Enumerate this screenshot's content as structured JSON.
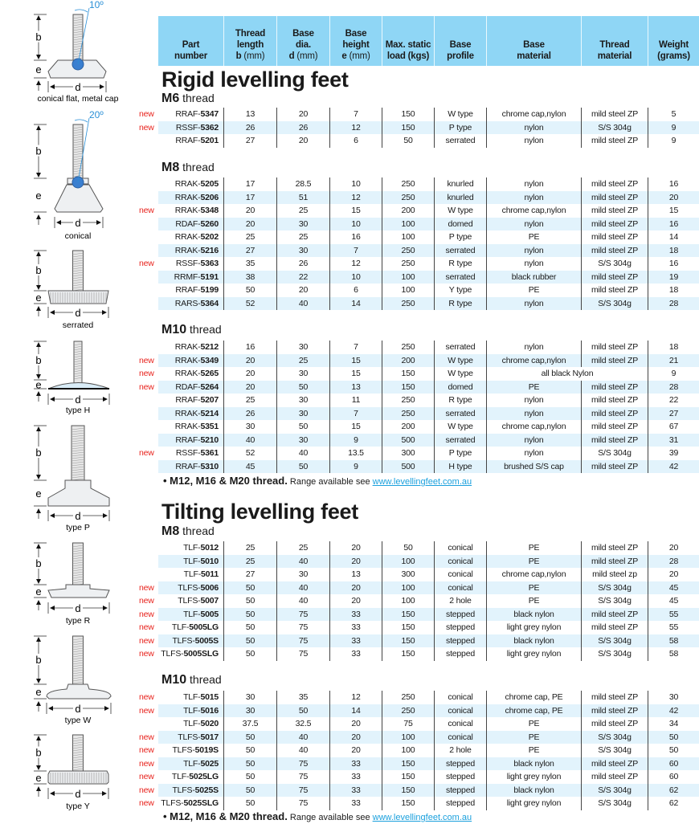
{
  "labels": {
    "new": "new"
  },
  "header": {
    "columns": [
      {
        "lines": [
          "Part",
          "number"
        ],
        "unit": ""
      },
      {
        "lines": [
          "Thread",
          "length",
          "b"
        ],
        "unit": " (mm)"
      },
      {
        "lines": [
          "Base",
          "dia.",
          "d"
        ],
        "unit": " (mm)"
      },
      {
        "lines": [
          "Base",
          "height",
          "e"
        ],
        "unit": " (mm)"
      },
      {
        "lines": [
          "Max. static",
          "load (kgs)"
        ],
        "unit": ""
      },
      {
        "lines": [
          "Base",
          "profile"
        ],
        "unit": ""
      },
      {
        "lines": [
          "Base",
          "material"
        ],
        "unit": ""
      },
      {
        "lines": [
          "Thread",
          "material"
        ],
        "unit": ""
      },
      {
        "lines": [
          "Weight",
          "(grams)"
        ],
        "unit": ""
      }
    ]
  },
  "sections": [
    {
      "title": "Rigid levelling feet",
      "groups": [
        {
          "thread_bold": "M6",
          "thread_label": " thread",
          "rows": [
            {
              "new": true,
              "part": "RRAF-5347",
              "b": "13",
              "d": "20",
              "e": "7",
              "load": "150",
              "profile": "W type",
              "material": "chrome cap,nylon",
              "thread_material": "mild steel ZP",
              "weight": "5"
            },
            {
              "new": true,
              "part": "RSSF-5362",
              "b": "26",
              "d": "26",
              "e": "12",
              "load": "150",
              "profile": "P type",
              "material": "nylon",
              "thread_material": "S/S 304g",
              "weight": "9"
            },
            {
              "new": false,
              "part": "RRAF-5201",
              "b": "27",
              "d": "20",
              "e": "6",
              "load": "50",
              "profile": "serrated",
              "material": "nylon",
              "thread_material": "mild steel ZP",
              "weight": "9"
            }
          ]
        },
        {
          "thread_bold": "M8",
          "thread_label": " thread",
          "rows": [
            {
              "new": false,
              "part": "RRAK-5205",
              "b": "17",
              "d": "28.5",
              "e": "10",
              "load": "250",
              "profile": "knurled",
              "material": "nylon",
              "thread_material": "mild steel ZP",
              "weight": "16"
            },
            {
              "new": false,
              "part": "RRAK-5206",
              "b": "17",
              "d": "51",
              "e": "12",
              "load": "250",
              "profile": "knurled",
              "material": "nylon",
              "thread_material": "mild steel ZP",
              "weight": "20"
            },
            {
              "new": true,
              "part": "RRAK-5348",
              "b": "20",
              "d": "25",
              "e": "15",
              "load": "200",
              "profile": "W type",
              "material": "chrome cap,nylon",
              "thread_material": "mild steel ZP",
              "weight": "15"
            },
            {
              "new": false,
              "part": "RDAF-5260",
              "b": "20",
              "d": "30",
              "e": "10",
              "load": "100",
              "profile": "domed",
              "material": "nylon",
              "thread_material": "mild steel ZP",
              "weight": "16"
            },
            {
              "new": false,
              "part": "RRAK-5202",
              "b": "25",
              "d": "25",
              "e": "16",
              "load": "100",
              "profile": "P type",
              "material": "PE",
              "thread_material": "mild steel ZP",
              "weight": "14"
            },
            {
              "new": false,
              "part": "RRAK-5216",
              "b": "27",
              "d": "30",
              "e": "7",
              "load": "250",
              "profile": "serrated",
              "material": "nylon",
              "thread_material": "mild steel ZP",
              "weight": "18"
            },
            {
              "new": true,
              "part": "RSSF-5363",
              "b": "35",
              "d": "26",
              "e": "12",
              "load": "250",
              "profile": "R type",
              "material": "nylon",
              "thread_material": "S/S 304g",
              "weight": "16"
            },
            {
              "new": false,
              "part": "RRMF-5191",
              "b": "38",
              "d": "22",
              "e": "10",
              "load": "100",
              "profile": "serrated",
              "material": "black rubber",
              "thread_material": "mild steel ZP",
              "weight": "19"
            },
            {
              "new": false,
              "part": "RRAF-5199",
              "b": "50",
              "d": "20",
              "e": "6",
              "load": "100",
              "profile": "Y type",
              "material": "PE",
              "thread_material": "mild steel ZP",
              "weight": "18"
            },
            {
              "new": false,
              "part": "RARS-5364",
              "b": "52",
              "d": "40",
              "e": "14",
              "load": "250",
              "profile": "R type",
              "material": "nylon",
              "thread_material": "S/S 304g",
              "weight": "28"
            }
          ]
        },
        {
          "thread_bold": "M10",
          "thread_label": " thread",
          "rows": [
            {
              "new": false,
              "part": "RRAK-5212",
              "b": "16",
              "d": "30",
              "e": "7",
              "load": "250",
              "profile": "serrated",
              "material": "nylon",
              "thread_material": "mild steel ZP",
              "weight": "18"
            },
            {
              "new": true,
              "part": "RRAK-5349",
              "b": "20",
              "d": "25",
              "e": "15",
              "load": "200",
              "profile": "W type",
              "material": "chrome cap,nylon",
              "thread_material": "mild steel ZP",
              "weight": "21"
            },
            {
              "new": true,
              "part": "RRAK-5265",
              "b": "20",
              "d": "30",
              "e": "15",
              "load": "150",
              "profile": "W type",
              "material": "all black Nylon",
              "thread_material": null,
              "weight": "9",
              "merged": true
            },
            {
              "new": true,
              "part": "RDAF-5264",
              "b": "20",
              "d": "50",
              "e": "13",
              "load": "150",
              "profile": "domed",
              "material": "PE",
              "thread_material": "mild steel ZP",
              "weight": "28"
            },
            {
              "new": false,
              "part": "RRAF-5207",
              "b": "25",
              "d": "30",
              "e": "11",
              "load": "250",
              "profile": "R type",
              "material": "nylon",
              "thread_material": "mild steel ZP",
              "weight": "22"
            },
            {
              "new": false,
              "part": "RRAK-5214",
              "b": "26",
              "d": "30",
              "e": "7",
              "load": "250",
              "profile": "serrated",
              "material": "nylon",
              "thread_material": "mild steel ZP",
              "weight": "27"
            },
            {
              "new": false,
              "part": "RRAK-5351",
              "b": "30",
              "d": "50",
              "e": "15",
              "load": "200",
              "profile": "W type",
              "material": "chrome cap,nylon",
              "thread_material": "mild steel ZP",
              "weight": "67"
            },
            {
              "new": false,
              "part": "RRAF-5210",
              "b": "40",
              "d": "30",
              "e": "9",
              "load": "500",
              "profile": "serrated",
              "material": "nylon",
              "thread_material": "mild steel ZP",
              "weight": "31"
            },
            {
              "new": true,
              "part": "RSSF-5361",
              "b": "52",
              "d": "40",
              "e": "13.5",
              "load": "300",
              "profile": "P type",
              "material": "nylon",
              "thread_material": "S/S 304g",
              "weight": "39"
            },
            {
              "new": false,
              "part": "RRAF-5310",
              "b": "45",
              "d": "50",
              "e": "9",
              "load": "500",
              "profile": "H type",
              "material": "brushed S/S cap",
              "thread_material": "mild steel ZP",
              "weight": "42"
            }
          ]
        }
      ],
      "footer": {
        "bullet": "•",
        "bold": "M12, M16 & M20 thread.",
        "text": " Range available see ",
        "link": "www.levellingfeet.com.au"
      }
    },
    {
      "title": "Tilting levelling feet",
      "groups": [
        {
          "thread_bold": "M8",
          "thread_label": " thread",
          "rows": [
            {
              "new": false,
              "part": "TLF-5012",
              "b": "25",
              "d": "25",
              "e": "20",
              "load": "50",
              "profile": "conical",
              "material": "PE",
              "thread_material": "mild steel ZP",
              "weight": "20"
            },
            {
              "new": false,
              "part": "TLF-5010",
              "b": "25",
              "d": "40",
              "e": "20",
              "load": "100",
              "profile": "conical",
              "material": "PE",
              "thread_material": "mild steel ZP",
              "weight": "28"
            },
            {
              "new": false,
              "part": "TLF-5011",
              "b": "27",
              "d": "30",
              "e": "13",
              "load": "300",
              "profile": "conical",
              "material": "chrome cap,nylon",
              "thread_material": "mild steel zp",
              "weight": "20"
            },
            {
              "new": true,
              "part": "TLFS-5006",
              "b": "50",
              "d": "40",
              "e": "20",
              "load": "100",
              "profile": "conical",
              "material": "PE",
              "thread_material": "S/S 304g",
              "weight": "45"
            },
            {
              "new": true,
              "part": "TLFS-5007",
              "b": "50",
              "d": "40",
              "e": "20",
              "load": "100",
              "profile": "2 hole",
              "material": "PE",
              "thread_material": "S/S 304g",
              "weight": "45"
            },
            {
              "new": true,
              "part": "TLF-5005",
              "b": "50",
              "d": "75",
              "e": "33",
              "load": "150",
              "profile": "stepped",
              "material": "black nylon",
              "thread_material": "mild steel ZP",
              "weight": "55"
            },
            {
              "new": true,
              "part": "TLF-5005LG",
              "b": "50",
              "d": "75",
              "e": "33",
              "load": "150",
              "profile": "stepped",
              "material": "light grey nylon",
              "thread_material": "mild steel ZP",
              "weight": "55"
            },
            {
              "new": true,
              "part": "TLFS-5005S",
              "b": "50",
              "d": "75",
              "e": "33",
              "load": "150",
              "profile": "stepped",
              "material": "black nylon",
              "thread_material": "S/S 304g",
              "weight": "58"
            },
            {
              "new": true,
              "part": "TLFS-5005SLG",
              "b": "50",
              "d": "75",
              "e": "33",
              "load": "150",
              "profile": "stepped",
              "material": "light grey nylon",
              "thread_material": "S/S 304g",
              "weight": "58"
            }
          ]
        },
        {
          "thread_bold": "M10",
          "thread_label": " thread",
          "rows": [
            {
              "new": true,
              "part": "TLF-5015",
              "b": "30",
              "d": "35",
              "e": "12",
              "load": "250",
              "profile": "conical",
              "material": "chrome cap, PE",
              "thread_material": "mild steel ZP",
              "weight": "30"
            },
            {
              "new": true,
              "part": "TLF-5016",
              "b": "30",
              "d": "50",
              "e": "14",
              "load": "250",
              "profile": "conical",
              "material": "chrome cap, PE",
              "thread_material": "mild steel ZP",
              "weight": "42"
            },
            {
              "new": false,
              "part": "TLF-5020",
              "b": "37.5",
              "d": "32.5",
              "e": "20",
              "load": "75",
              "profile": "conical",
              "material": "PE",
              "thread_material": "mild steel ZP",
              "weight": "34"
            },
            {
              "new": true,
              "part": "TLFS-5017",
              "b": "50",
              "d": "40",
              "e": "20",
              "load": "100",
              "profile": "conical",
              "material": "PE",
              "thread_material": "S/S 304g",
              "weight": "50"
            },
            {
              "new": true,
              "part": "TLFS-5019S",
              "b": "50",
              "d": "40",
              "e": "20",
              "load": "100",
              "profile": "2 hole",
              "material": "PE",
              "thread_material": "S/S 304g",
              "weight": "50"
            },
            {
              "new": true,
              "part": "TLF-5025",
              "b": "50",
              "d": "75",
              "e": "33",
              "load": "150",
              "profile": "stepped",
              "material": "black nylon",
              "thread_material": "mild steel ZP",
              "weight": "60"
            },
            {
              "new": true,
              "part": "TLF-5025LG",
              "b": "50",
              "d": "75",
              "e": "33",
              "load": "150",
              "profile": "stepped",
              "material": "light grey nylon",
              "thread_material": "mild steel ZP",
              "weight": "60"
            },
            {
              "new": true,
              "part": "TLFS-5025S",
              "b": "50",
              "d": "75",
              "e": "33",
              "load": "150",
              "profile": "stepped",
              "material": "black nylon",
              "thread_material": "S/S 304g",
              "weight": "62"
            },
            {
              "new": true,
              "part": "TLFS-5025SLG",
              "b": "50",
              "d": "75",
              "e": "33",
              "load": "150",
              "profile": "stepped",
              "material": "light grey nylon",
              "thread_material": "S/S 304g",
              "weight": "62"
            }
          ]
        }
      ],
      "footer": {
        "bullet": "•",
        "bold": "M12, M16 & M20 thread.",
        "text": " Range available see ",
        "link": "www.levellingfeet.com.au"
      }
    }
  ],
  "diagrams": [
    {
      "type": "conical-flat",
      "caption": "conical flat, metal cap",
      "angle": "10º",
      "b": "b",
      "e": "e",
      "d": "d"
    },
    {
      "type": "conical",
      "caption": "conical",
      "angle": "20º",
      "b": "b",
      "e": "e",
      "d": "d"
    },
    {
      "type": "serrated",
      "caption": "serrated",
      "b": "b",
      "e": "e",
      "d": "d"
    },
    {
      "type": "type-h",
      "caption": "type H",
      "b": "b",
      "e": "e",
      "d": "d"
    },
    {
      "type": "type-p",
      "caption": "type P",
      "b": "b",
      "e": "e",
      "d": "d"
    },
    {
      "type": "type-r",
      "caption": "type R",
      "b": "b",
      "e": "e",
      "d": "d"
    },
    {
      "type": "type-w",
      "caption": "type W",
      "b": "b",
      "e": "e",
      "d": "d"
    },
    {
      "type": "type-y",
      "caption": "type Y",
      "b": "b",
      "e": "e",
      "d": "d"
    }
  ],
  "colors": {
    "header_bg": "#8fd6f5",
    "alt_row": "#e2f3fc",
    "new": "#e8231d",
    "link": "#1aa0dd",
    "angle": "#2a8fd6"
  }
}
